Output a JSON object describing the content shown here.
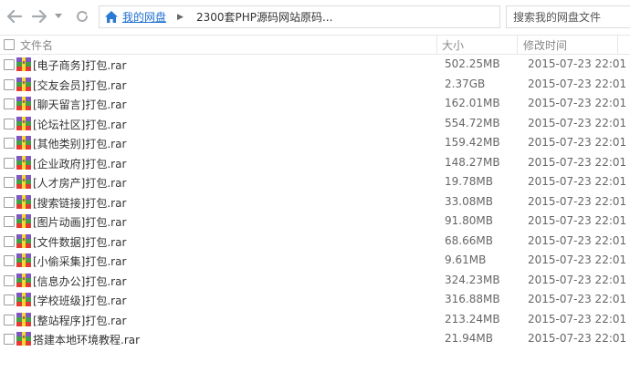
{
  "toolbar": {
    "breadcrumb_root": "我的网盘",
    "breadcrumb_current": "2300套PHP源码网站原码...",
    "search_placeholder": "搜索我的网盘文件"
  },
  "columns": {
    "name": "文件名",
    "size": "大小",
    "modified": "修改时间"
  },
  "files": [
    {
      "name": "[电子商务]打包.rar",
      "size": "502.25MB",
      "modified": "2015-07-23 22:01"
    },
    {
      "name": "[交友会员]打包.rar",
      "size": "2.37GB",
      "modified": "2015-07-23 22:01"
    },
    {
      "name": "[聊天留言]打包.rar",
      "size": "162.01MB",
      "modified": "2015-07-23 22:01"
    },
    {
      "name": "[论坛社区]打包.rar",
      "size": "554.72MB",
      "modified": "2015-07-23 22:01"
    },
    {
      "name": "[其他类别]打包.rar",
      "size": "159.42MB",
      "modified": "2015-07-23 22:01"
    },
    {
      "name": "[企业政府]打包.rar",
      "size": "148.27MB",
      "modified": "2015-07-23 22:01"
    },
    {
      "name": "[人才房产]打包.rar",
      "size": "19.78MB",
      "modified": "2015-07-23 22:01"
    },
    {
      "name": "[搜索链接]打包.rar",
      "size": "33.08MB",
      "modified": "2015-07-23 22:01"
    },
    {
      "name": "[图片动画]打包.rar",
      "size": "91.80MB",
      "modified": "2015-07-23 22:01"
    },
    {
      "name": "[文件数据]打包.rar",
      "size": "68.66MB",
      "modified": "2015-07-23 22:01"
    },
    {
      "name": "[小偷采集]打包.rar",
      "size": "9.61MB",
      "modified": "2015-07-23 22:01"
    },
    {
      "name": "[信息办公]打包.rar",
      "size": "324.23MB",
      "modified": "2015-07-23 22:01"
    },
    {
      "name": "[学校班级]打包.rar",
      "size": "316.88MB",
      "modified": "2015-07-23 22:01"
    },
    {
      "name": "[整站程序]打包.rar",
      "size": "213.24MB",
      "modified": "2015-07-23 22:01"
    },
    {
      "name": "搭建本地环境教程.rar",
      "size": "21.94MB",
      "modified": "2015-07-23 22:01"
    }
  ],
  "icons": {
    "back": "arrow-left-icon",
    "forward": "arrow-right-icon",
    "history": "chevron-down-icon",
    "refresh": "refresh-icon",
    "home": "home-icon",
    "file": "rar-archive-icon"
  },
  "colors": {
    "link": "#1f6fd0",
    "icon_gray": "#9aa0a6",
    "home_blue": "#2b7bd6"
  }
}
